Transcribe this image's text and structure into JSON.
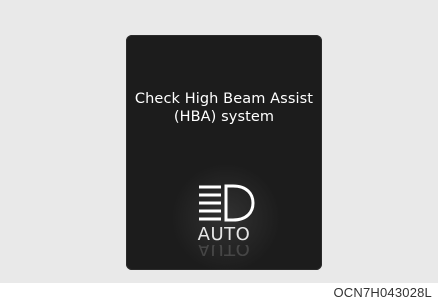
{
  "display": {
    "message_line1": "Check High Beam Assist",
    "message_line2": "(HBA) system",
    "icon": "high-beam-assist-icon",
    "auto_label": "AUTO"
  },
  "figure_code": "OCN7H043028L",
  "colors": {
    "background": "#e9e9e9",
    "display_bg": "#1c1c1c",
    "text": "#ffffff"
  }
}
